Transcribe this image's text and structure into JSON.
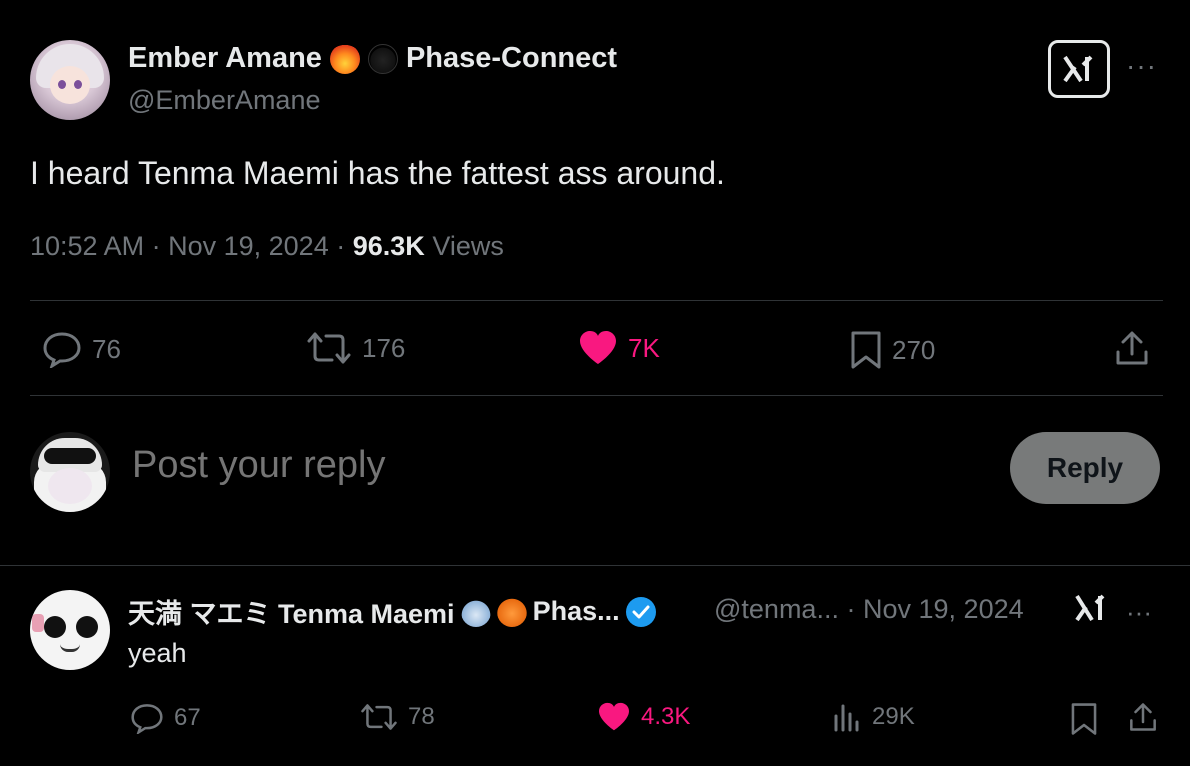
{
  "tweet": {
    "author_name": "Ember Amane",
    "author_suffix": "Phase-Connect",
    "handle": "@EmberAmane",
    "text": "I heard Tenma Maemi has the fattest ass around.",
    "time": "10:52 AM",
    "date": "Nov 19, 2024",
    "views_count": "96.3K",
    "views_label": "Views",
    "actions": {
      "replies": "76",
      "retweets": "176",
      "likes": "7K",
      "bookmarks": "270"
    },
    "more_label": "···",
    "name_emojis": [
      "fire-emoji",
      "black-cat-emoji"
    ]
  },
  "composer": {
    "placeholder": "Post your reply",
    "reply_button": "Reply"
  },
  "reply": {
    "author_name": "天満 マエミ Tenma Maemi",
    "author_suffix": "Phas...",
    "handle": "@tenma...",
    "date_separator": "·",
    "date": "Nov 19, 2024",
    "text": "yeah",
    "verified": true,
    "actions": {
      "replies": "67",
      "retweets": "78",
      "likes": "4.3K",
      "views": "29K"
    },
    "more_label": "···",
    "name_emojis": [
      "sake-emoji",
      "fox-emoji"
    ]
  },
  "colors": {
    "background": "#000000",
    "text_primary": "#e7e9ea",
    "text_secondary": "#71767b",
    "like_pink": "#f91880",
    "verified_blue": "#1d9bf0",
    "divider": "#2f3336",
    "reply_button_bg": "#787a7a"
  }
}
